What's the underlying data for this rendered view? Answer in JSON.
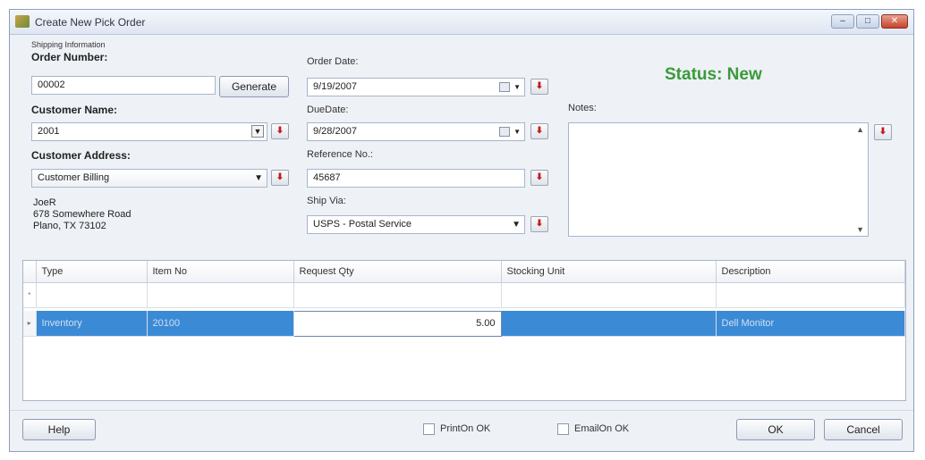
{
  "window": {
    "title": "Create New Pick Order",
    "controls": {
      "minimize": "–",
      "maximize": "□",
      "close": "✕"
    }
  },
  "shipping": {
    "group_label": "Shipping Information",
    "order_number_label": "Order Number:",
    "order_number": "00002",
    "generate_label": "Generate",
    "customer_name_label": "Customer Name:",
    "customer_name": "2001",
    "customer_address_label": "Customer Address:",
    "customer_address": "Customer Billing",
    "address_lines": [
      "JoeR",
      "678 Somewhere Road",
      "Plano, TX 73102"
    ]
  },
  "dates": {
    "order_date_label": "Order Date:",
    "order_date": "9/19/2007",
    "due_date_label": "DueDate:",
    "due_date": "9/28/2007",
    "reference_label": "Reference No.:",
    "reference": "45687",
    "ship_via_label": "Ship Via:",
    "ship_via": "USPS - Postal Service"
  },
  "status": {
    "text": "Status: New",
    "color": "#3a9a3a"
  },
  "notes": {
    "label": "Notes:",
    "value": ""
  },
  "grid": {
    "columns": [
      "Type",
      "Item No",
      "Request Qty",
      "Stocking Unit",
      "Description"
    ],
    "new_row_marker": "*",
    "rows": [
      {
        "marker": "▸",
        "type": "Inventory",
        "item_no": "20100",
        "qty": "5.00",
        "unit": "",
        "description": "Dell Monitor"
      }
    ],
    "selection_color": "#3b8ad6"
  },
  "footer": {
    "help_label": "Help",
    "print_label": "PrintOn OK",
    "email_label": "EmailOn OK",
    "ok_label": "OK",
    "cancel_label": "Cancel"
  }
}
